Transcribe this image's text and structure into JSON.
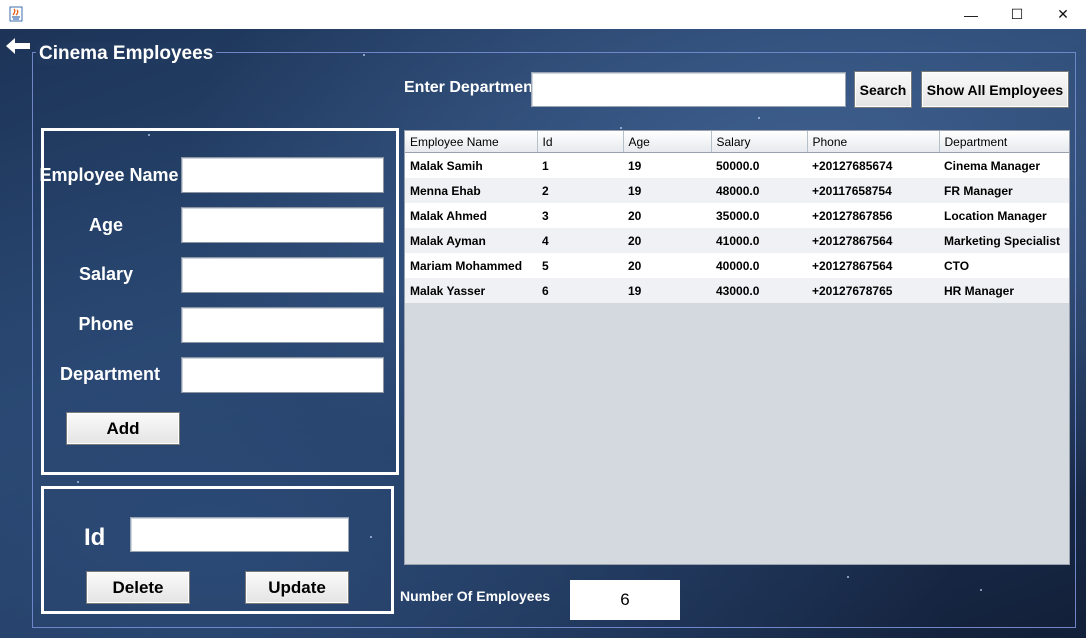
{
  "window": {
    "icon": "java-app-icon",
    "min_glyph": "—",
    "max_glyph": "☐",
    "close_glyph": "✕"
  },
  "panel_title": "Cinema Employees",
  "search": {
    "label": "Enter Department",
    "value": "",
    "search_button": "Search",
    "show_all_button": "Show All Employees"
  },
  "form": {
    "fields": [
      {
        "label": "Employee Name",
        "value": ""
      },
      {
        "label": "Age",
        "value": ""
      },
      {
        "label": "Salary",
        "value": ""
      },
      {
        "label": "Phone",
        "value": ""
      },
      {
        "label": "Department",
        "value": ""
      }
    ],
    "add_button": "Add"
  },
  "id_panel": {
    "label": "Id",
    "value": "",
    "delete_button": "Delete",
    "update_button": "Update"
  },
  "table": {
    "columns": [
      "Employee Name",
      "Id",
      "Age",
      "Salary",
      "Phone",
      "Department"
    ],
    "rows": [
      [
        "Malak Samih",
        "1",
        "19",
        "50000.0",
        "+20127685674",
        "Cinema Manager"
      ],
      [
        "Menna Ehab",
        "2",
        "19",
        "48000.0",
        "+20117658754",
        "FR Manager"
      ],
      [
        "Malak Ahmed",
        "3",
        "20",
        "35000.0",
        "+20127867856",
        "Location Manager"
      ],
      [
        "Malak Ayman",
        "4",
        "20",
        "41000.0",
        "+20127867564",
        "Marketing Specialist"
      ],
      [
        "Mariam Mohammed",
        "5",
        "20",
        "40000.0",
        "+20127867564",
        "CTO"
      ],
      [
        "Malak Yasser",
        "6",
        "19",
        "43000.0",
        "+20127678765",
        "HR Manager"
      ]
    ]
  },
  "footer": {
    "count_label": "Number Of Employees",
    "count_value": "6"
  },
  "colors": {
    "background": "#213a60",
    "frame_border": "#6f86c8",
    "table_bg": "#d4d9df"
  }
}
